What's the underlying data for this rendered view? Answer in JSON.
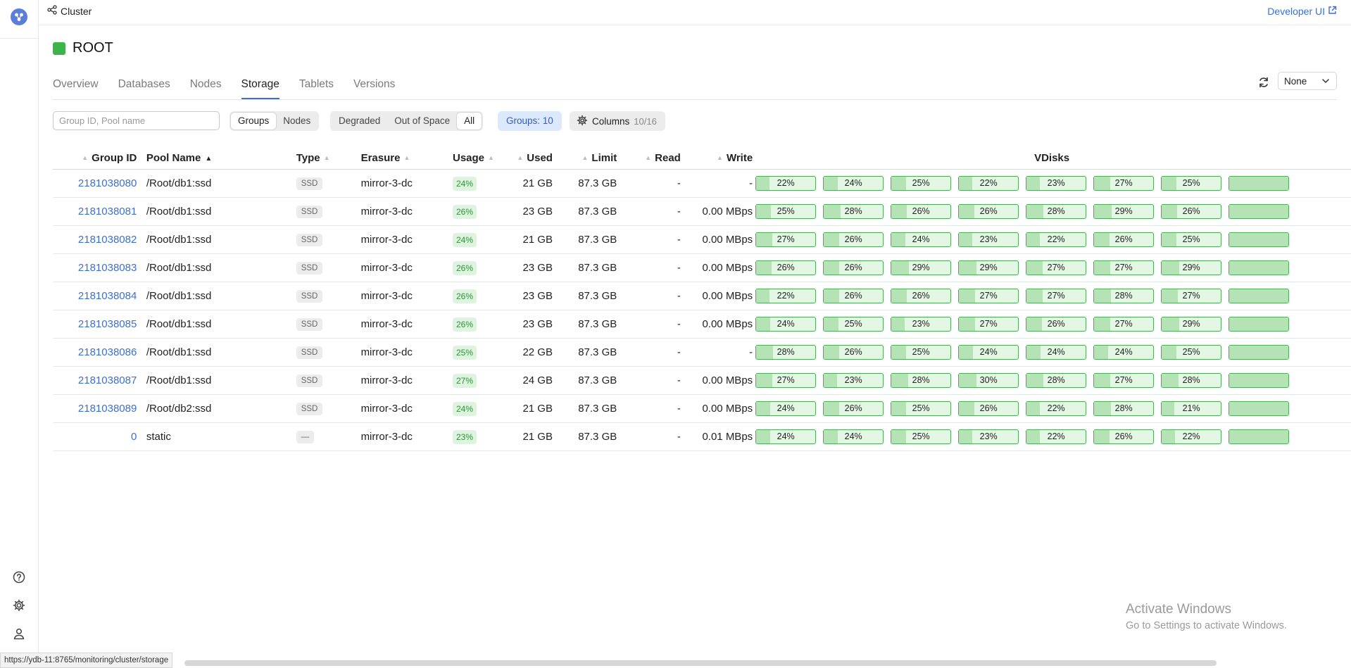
{
  "header": {
    "breadcrumb": "Cluster",
    "developer_link": "Developer UI"
  },
  "page": {
    "title": "ROOT",
    "status_color": "#3bb54a"
  },
  "tabs": [
    {
      "label": "Overview",
      "active": false
    },
    {
      "label": "Databases",
      "active": false
    },
    {
      "label": "Nodes",
      "active": false
    },
    {
      "label": "Storage",
      "active": true
    },
    {
      "label": "Tablets",
      "active": false
    },
    {
      "label": "Versions",
      "active": false
    }
  ],
  "refresh_select": {
    "value": "None"
  },
  "filters": {
    "search_placeholder": "Group ID, Pool name",
    "type_options": [
      "Groups",
      "Nodes"
    ],
    "type_selected": "Groups",
    "visibility_options": [
      "Degraded",
      "Out of Space",
      "All"
    ],
    "visibility_selected": "All",
    "groups_count": "Groups: 10",
    "columns_label": "Columns",
    "columns_count": "10/16"
  },
  "table": {
    "headers": {
      "group_id": "Group ID",
      "pool_name": "Pool Name",
      "type": "Type",
      "erasure": "Erasure",
      "usage": "Usage",
      "used": "Used",
      "limit": "Limit",
      "read": "Read",
      "write": "Write",
      "vdisks": "VDisks"
    },
    "rows": [
      {
        "group_id": "2181038080",
        "pool_name": "/Root/db1:ssd",
        "type": "SSD",
        "erasure": "mirror-3-dc",
        "usage": "24%",
        "used": "21 GB",
        "limit": "87.3 GB",
        "read": "-",
        "write": "-",
        "vdisks": [
          "22%",
          "24%",
          "25%",
          "22%",
          "23%",
          "27%",
          "25%",
          ""
        ]
      },
      {
        "group_id": "2181038081",
        "pool_name": "/Root/db1:ssd",
        "type": "SSD",
        "erasure": "mirror-3-dc",
        "usage": "26%",
        "used": "23 GB",
        "limit": "87.3 GB",
        "read": "-",
        "write": "0.00 MBps",
        "vdisks": [
          "25%",
          "28%",
          "26%",
          "26%",
          "28%",
          "29%",
          "26%",
          ""
        ]
      },
      {
        "group_id": "2181038082",
        "pool_name": "/Root/db1:ssd",
        "type": "SSD",
        "erasure": "mirror-3-dc",
        "usage": "24%",
        "used": "21 GB",
        "limit": "87.3 GB",
        "read": "-",
        "write": "0.00 MBps",
        "vdisks": [
          "27%",
          "26%",
          "24%",
          "23%",
          "22%",
          "26%",
          "25%",
          ""
        ]
      },
      {
        "group_id": "2181038083",
        "pool_name": "/Root/db1:ssd",
        "type": "SSD",
        "erasure": "mirror-3-dc",
        "usage": "26%",
        "used": "23 GB",
        "limit": "87.3 GB",
        "read": "-",
        "write": "0.00 MBps",
        "vdisks": [
          "26%",
          "26%",
          "29%",
          "29%",
          "27%",
          "27%",
          "29%",
          ""
        ]
      },
      {
        "group_id": "2181038084",
        "pool_name": "/Root/db1:ssd",
        "type": "SSD",
        "erasure": "mirror-3-dc",
        "usage": "26%",
        "used": "23 GB",
        "limit": "87.3 GB",
        "read": "-",
        "write": "0.00 MBps",
        "vdisks": [
          "22%",
          "26%",
          "26%",
          "27%",
          "27%",
          "28%",
          "27%",
          ""
        ]
      },
      {
        "group_id": "2181038085",
        "pool_name": "/Root/db1:ssd",
        "type": "SSD",
        "erasure": "mirror-3-dc",
        "usage": "26%",
        "used": "23 GB",
        "limit": "87.3 GB",
        "read": "-",
        "write": "0.00 MBps",
        "vdisks": [
          "24%",
          "25%",
          "23%",
          "27%",
          "26%",
          "27%",
          "29%",
          ""
        ]
      },
      {
        "group_id": "2181038086",
        "pool_name": "/Root/db1:ssd",
        "type": "SSD",
        "erasure": "mirror-3-dc",
        "usage": "25%",
        "used": "22 GB",
        "limit": "87.3 GB",
        "read": "-",
        "write": "-",
        "vdisks": [
          "28%",
          "26%",
          "25%",
          "24%",
          "24%",
          "24%",
          "25%",
          ""
        ]
      },
      {
        "group_id": "2181038087",
        "pool_name": "/Root/db1:ssd",
        "type": "SSD",
        "erasure": "mirror-3-dc",
        "usage": "27%",
        "used": "24 GB",
        "limit": "87.3 GB",
        "read": "-",
        "write": "0.00 MBps",
        "vdisks": [
          "27%",
          "23%",
          "28%",
          "30%",
          "28%",
          "27%",
          "28%",
          ""
        ]
      },
      {
        "group_id": "2181038089",
        "pool_name": "/Root/db2:ssd",
        "type": "SSD",
        "erasure": "mirror-3-dc",
        "usage": "24%",
        "used": "21 GB",
        "limit": "87.3 GB",
        "read": "-",
        "write": "0.00 MBps",
        "vdisks": [
          "24%",
          "26%",
          "25%",
          "26%",
          "22%",
          "28%",
          "21%",
          ""
        ]
      },
      {
        "group_id": "0",
        "pool_name": "static",
        "type": "—",
        "erasure": "mirror-3-dc",
        "usage": "23%",
        "used": "21 GB",
        "limit": "87.3 GB",
        "read": "-",
        "write": "0.01 MBps",
        "vdisks": [
          "24%",
          "24%",
          "25%",
          "23%",
          "22%",
          "26%",
          "22%",
          ""
        ]
      }
    ]
  },
  "watermark": {
    "line1": "Activate Windows",
    "line2": "Go to Settings to activate Windows."
  },
  "status_bar": {
    "url": "https://ydb-11:8765/monitoring/cluster/storage"
  },
  "icons": {
    "logo": "ydb-logo-icon",
    "help": "help-icon",
    "settings": "gear-icon",
    "user": "user-icon"
  }
}
